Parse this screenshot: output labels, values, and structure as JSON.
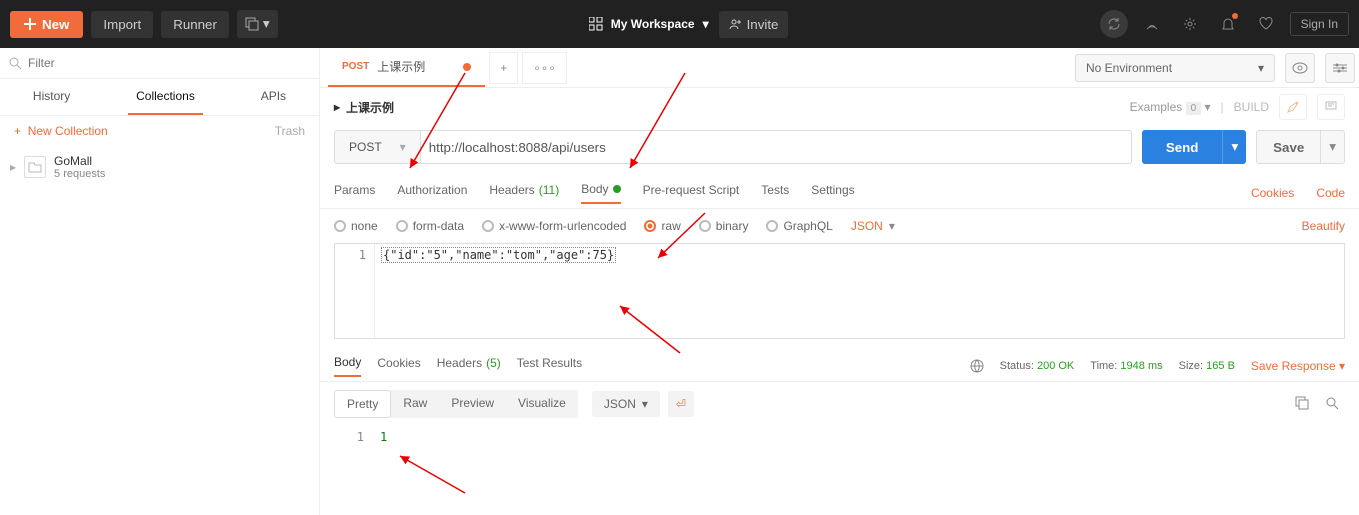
{
  "topbar": {
    "new": "New",
    "import": "Import",
    "runner": "Runner",
    "workspace": "My Workspace",
    "invite": "Invite",
    "signin": "Sign In"
  },
  "sidebar": {
    "filter_placeholder": "Filter",
    "tabs": {
      "history": "History",
      "collections": "Collections",
      "apis": "APIs"
    },
    "new_collection": "New Collection",
    "trash": "Trash",
    "items": [
      {
        "name": "GoMall",
        "meta": "5 requests"
      }
    ]
  },
  "env": {
    "none": "No Environment"
  },
  "tab": {
    "method": "POST",
    "title": "上课示例"
  },
  "request": {
    "title": "上课示例",
    "examples": "Examples",
    "examples_count": "0",
    "build": "BUILD",
    "method": "POST",
    "url": "http://localhost:8088/api/users",
    "send": "Send",
    "save": "Save",
    "subtabs": {
      "params": "Params",
      "auth": "Authorization",
      "headers": "Headers",
      "headers_count": "(11)",
      "body": "Body",
      "prescript": "Pre-request Script",
      "tests": "Tests",
      "settings": "Settings",
      "cookies": "Cookies",
      "code": "Code"
    },
    "bodytypes": {
      "none": "none",
      "formdata": "form-data",
      "urlenc": "x-www-form-urlencoded",
      "raw": "raw",
      "binary": "binary",
      "graphql": "GraphQL",
      "json": "JSON",
      "beautify": "Beautify"
    },
    "editor": {
      "line": "1",
      "content": "{\"id\":\"5\",\"name\":\"tom\",\"age\":75}"
    }
  },
  "response": {
    "tabs": {
      "body": "Body",
      "cookies": "Cookies",
      "headers": "Headers",
      "headers_count": "(5)",
      "tests": "Test Results"
    },
    "status_label": "Status:",
    "status_val": "200 OK",
    "time_label": "Time:",
    "time_val": "1948 ms",
    "size_label": "Size:",
    "size_val": "165 B",
    "save": "Save Response",
    "views": {
      "pretty": "Pretty",
      "raw": "Raw",
      "preview": "Preview",
      "visualize": "Visualize",
      "json": "JSON"
    },
    "body": {
      "line": "1",
      "value": "1"
    }
  }
}
